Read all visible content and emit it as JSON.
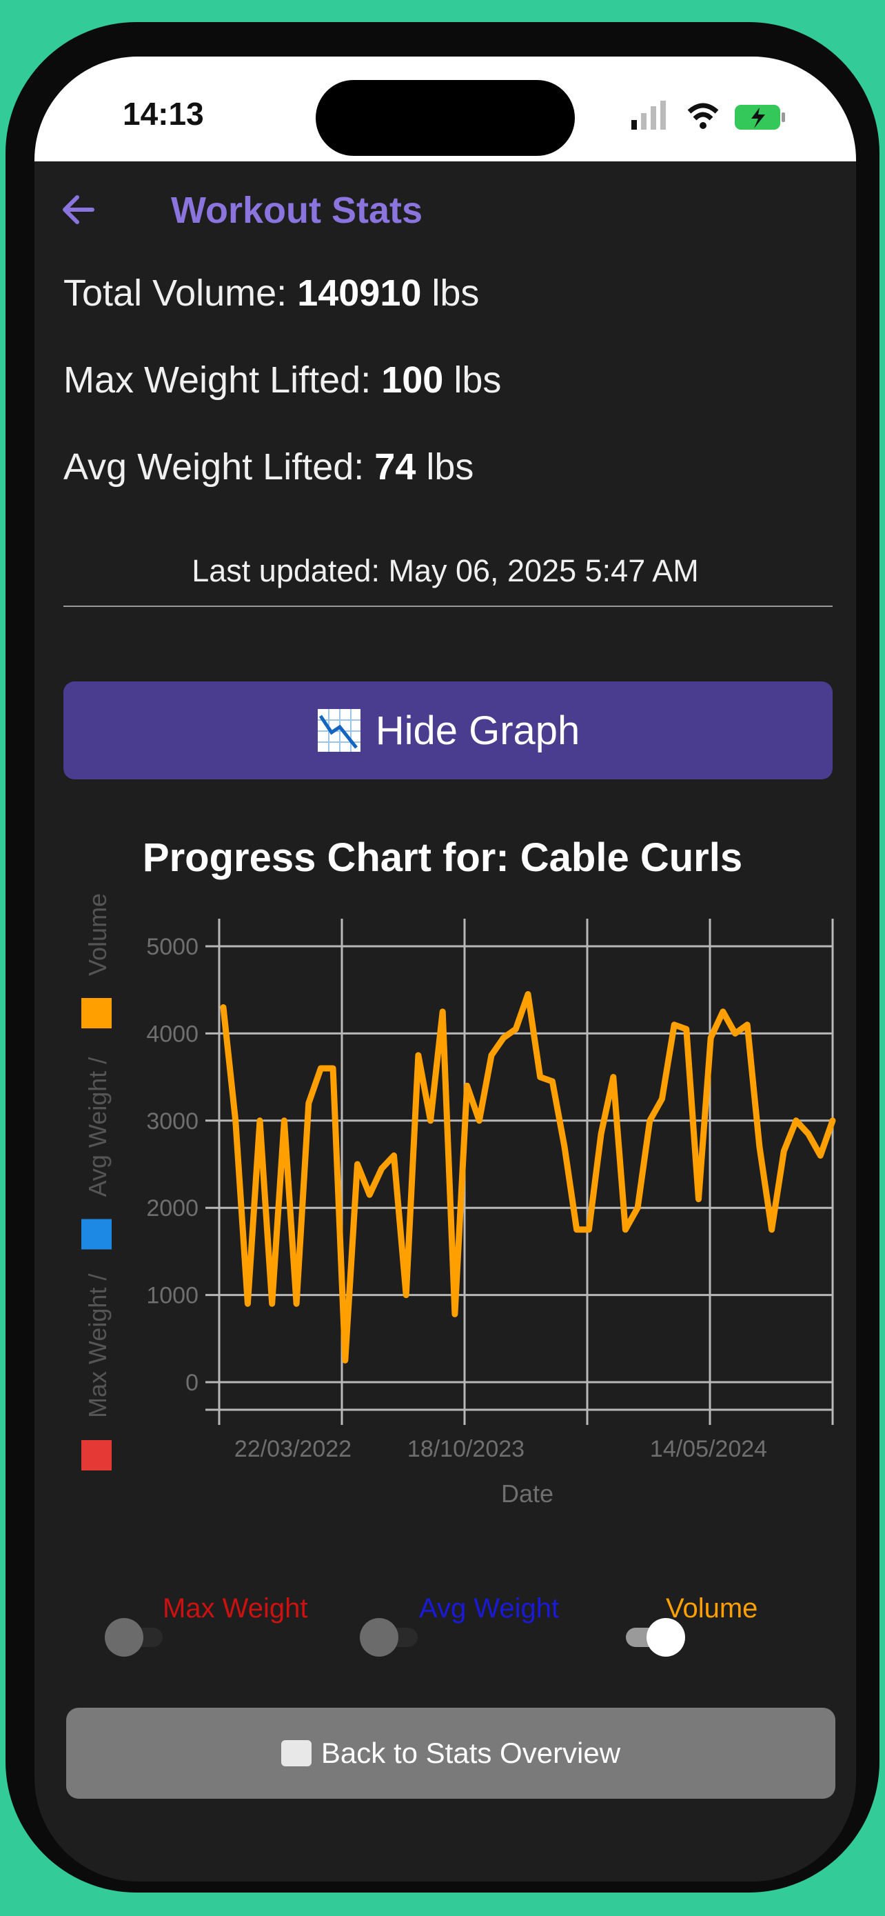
{
  "status_bar": {
    "time": "14:13"
  },
  "header": {
    "title": "Workout Stats"
  },
  "stats": [
    {
      "label": "Total Volume: ",
      "value": "140910",
      "unit": " lbs"
    },
    {
      "label": "Max Weight Lifted: ",
      "value": "100",
      "unit": " lbs"
    },
    {
      "label": "Avg Weight Lifted: ",
      "value": "74",
      "unit": " lbs"
    }
  ],
  "last_updated": "Last updated: May 06, 2025 5:47 AM",
  "hide_graph_label": "Hide Graph",
  "chart_title": "Progress Chart for: Cable Curls",
  "chart_data": {
    "type": "line",
    "title": "Progress Chart for: Cable Curls",
    "xlabel": "Date",
    "ylabel": "Max Weight / Avg Weight / Volume",
    "ylim": [
      0,
      5000
    ],
    "yticks": [
      0,
      1000,
      2000,
      3000,
      4000,
      5000
    ],
    "x_tick_labels": [
      "22/03/2022",
      "18/10/2023",
      "14/05/2024"
    ],
    "grid": true,
    "series": [
      {
        "name": "Volume",
        "color": "#ff9f00",
        "values": [
          4300,
          3000,
          900,
          3000,
          900,
          3000,
          900,
          3200,
          3600,
          3600,
          250,
          2500,
          2150,
          2450,
          2600,
          1000,
          3750,
          3000,
          4250,
          780,
          3400,
          3000,
          3750,
          3950,
          4050,
          4450,
          3500,
          3450,
          2700,
          1750,
          1750,
          2850,
          3500,
          1750,
          2000,
          3000,
          3250,
          4100,
          4050,
          2100,
          3950,
          4250,
          4000,
          4100,
          2700,
          1750,
          2650,
          3000,
          2850,
          2600,
          3000
        ]
      }
    ],
    "legend": [
      {
        "name": "Max Weight",
        "color": "#e53935"
      },
      {
        "name": "Avg Weight",
        "color": "#1e88e5"
      },
      {
        "name": "Volume",
        "color": "#ff9f00"
      }
    ]
  },
  "toggles": [
    {
      "label": "Max Weight",
      "color": "#cc1111",
      "on": false
    },
    {
      "label": "Avg Weight",
      "color": "#1a1ad6",
      "on": false
    },
    {
      "label": "Volume",
      "color": "#ff9f00",
      "on": true
    }
  ],
  "back_button_label": "Back to Stats Overview"
}
